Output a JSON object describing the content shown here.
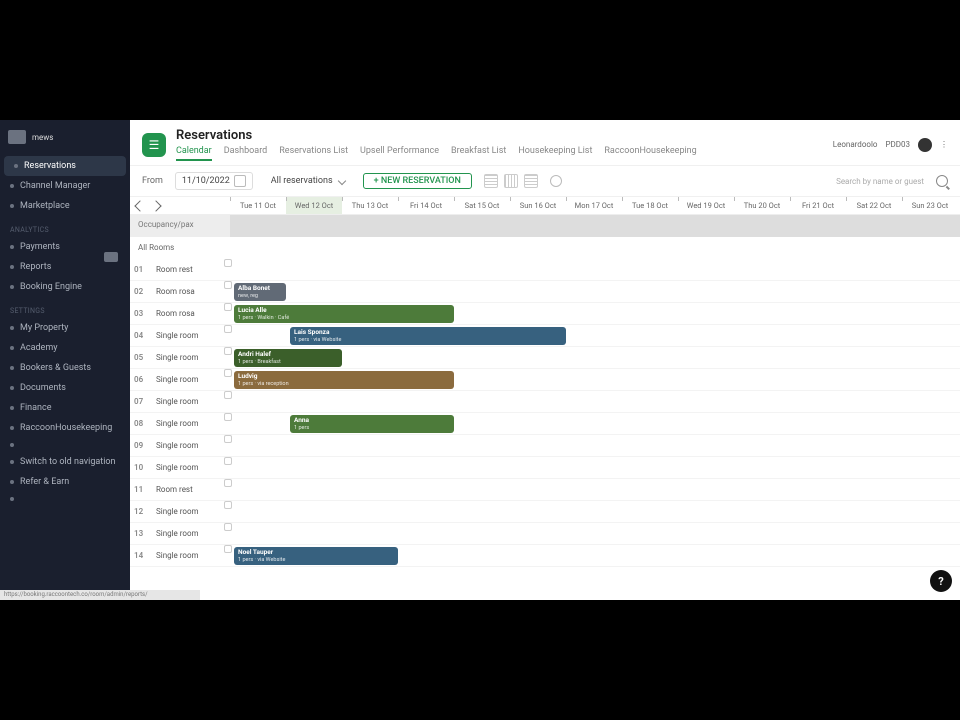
{
  "brand": {
    "name": "mews"
  },
  "sidebar": {
    "groups": [
      {
        "label": "",
        "items": [
          {
            "label": "Reservations",
            "active": true
          },
          {
            "label": "Channel Manager"
          },
          {
            "label": "Marketplace"
          }
        ]
      },
      {
        "label": "Analytics",
        "items": [
          {
            "label": "Payments"
          },
          {
            "label": "Reports",
            "caretCursor": true
          },
          {
            "label": "Booking Engine"
          }
        ]
      },
      {
        "label": "Settings",
        "items": [
          {
            "label": "My Property"
          },
          {
            "label": "Academy"
          },
          {
            "label": "Bookers & Guests"
          },
          {
            "label": "Documents"
          },
          {
            "label": "Finance"
          },
          {
            "label": "RaccoonHousekeeping"
          },
          {
            "label": ""
          }
        ]
      },
      {
        "label": "",
        "items": [
          {
            "label": "Switch to old navigation"
          },
          {
            "label": "Refer & Earn"
          },
          {
            "label": ""
          }
        ]
      }
    ]
  },
  "header": {
    "title": "Reservations",
    "tabs": [
      {
        "label": "Calendar",
        "active": true
      },
      {
        "label": "Dashboard"
      },
      {
        "label": "Reservations List"
      },
      {
        "label": "Upsell Performance"
      },
      {
        "label": "Breakfast List"
      },
      {
        "label": "Housekeeping List"
      },
      {
        "label": "RaccoonHousekeeping"
      }
    ],
    "user": "Leonardoolo",
    "userCode": "PDD03"
  },
  "toolbar": {
    "fromLabel": "From",
    "fromDate": "11/10/2022",
    "filter": "All reservations",
    "newReservation": "+ NEW RESERVATION",
    "searchPlaceholder": "Search by name or guest"
  },
  "calendar": {
    "days": [
      "Tue 11 Oct",
      "Wed 12 Oct",
      "Thu 13 Oct",
      "Fri 14 Oct",
      "Sat 15 Oct",
      "Sun 16 Oct",
      "Mon 17 Oct",
      "Tue 18 Oct",
      "Wed 19 Oct",
      "Thu 20 Oct",
      "Fri 21 Oct",
      "Sat 22 Oct",
      "Sun 23 Oct"
    ],
    "todayIndex": 1,
    "occupancyLabel": "Occupancy/pax",
    "allRoomsLabel": "All Rooms",
    "rooms": [
      {
        "num": "01",
        "name": "Room rest"
      },
      {
        "num": "02",
        "name": "Room rosa"
      },
      {
        "num": "03",
        "name": "Room rosa"
      },
      {
        "num": "04",
        "name": "Single room"
      },
      {
        "num": "05",
        "name": "Single room"
      },
      {
        "num": "06",
        "name": "Single room"
      },
      {
        "num": "07",
        "name": "Single room"
      },
      {
        "num": "08",
        "name": "Single room"
      },
      {
        "num": "09",
        "name": "Single room"
      },
      {
        "num": "10",
        "name": "Single room"
      },
      {
        "num": "11",
        "name": "Room rest"
      },
      {
        "num": "12",
        "name": "Single room"
      },
      {
        "num": "13",
        "name": "Single room"
      },
      {
        "num": "14",
        "name": "Single room"
      }
    ],
    "reservations": [
      {
        "room": 1,
        "startDay": 0,
        "span": 1,
        "guest": "Alba Bonet",
        "sub": "new, reg",
        "color": "c-grey"
      },
      {
        "room": 2,
        "startDay": 0,
        "span": 4,
        "guest": "Lucia Alle",
        "sub": "1 pers · Walkin · Café",
        "color": "c-green"
      },
      {
        "room": 3,
        "startDay": 1,
        "span": 5,
        "guest": "Lais Sponza",
        "sub": "1 pers · via Website",
        "color": "c-blue"
      },
      {
        "room": 4,
        "startDay": 0,
        "span": 2,
        "guest": "Andri Halef",
        "sub": "1 pers · Breakfast",
        "color": "c-dgreen"
      },
      {
        "room": 5,
        "startDay": 0,
        "span": 4,
        "guest": "Ludvig",
        "sub": "1 pers · via reception",
        "color": "c-brown"
      },
      {
        "room": 7,
        "startDay": 1,
        "span": 3,
        "guest": "Anna",
        "sub": "1 pers",
        "color": "c-green"
      },
      {
        "room": 13,
        "startDay": 0,
        "span": 3,
        "guest": "Noel Tauper",
        "sub": "1 pers · via Website",
        "color": "c-blue"
      }
    ]
  },
  "statusBar": "https://booking.raccoontech.co/room/admin/reports/",
  "helpBubble": "?"
}
